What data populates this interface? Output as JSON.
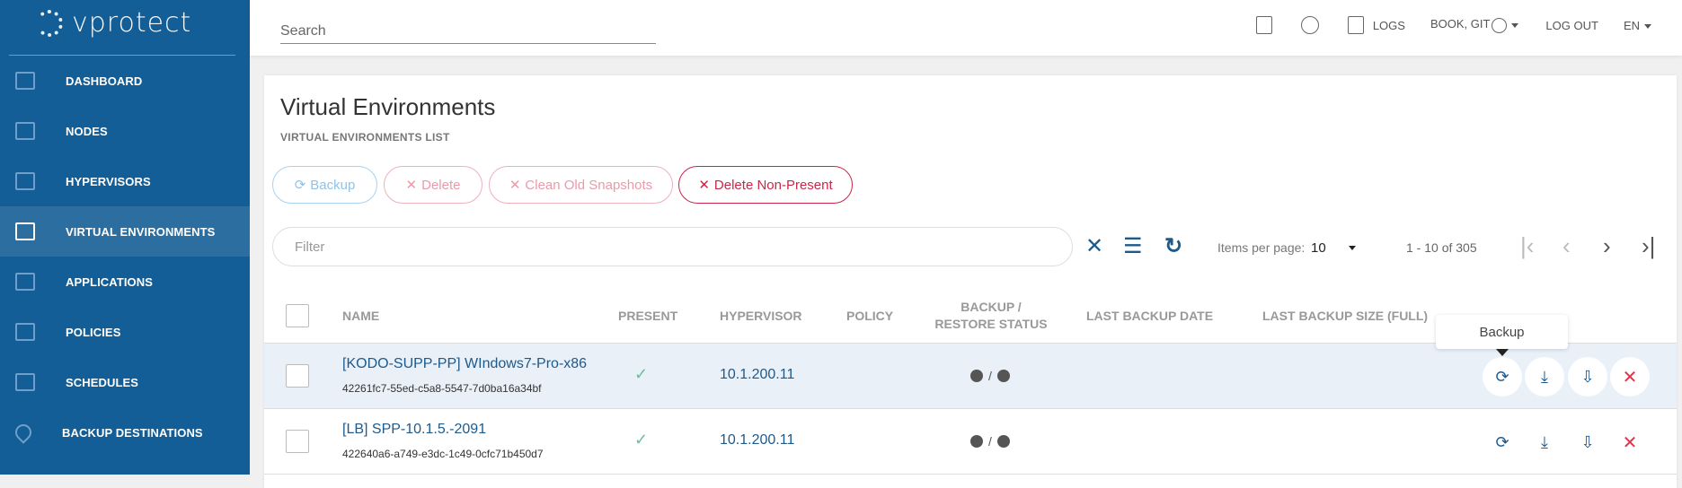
{
  "brand": {
    "name": "vprotect"
  },
  "sidebar": {
    "items": [
      {
        "label": "DASHBOARD",
        "icon": "bar-chart-icon"
      },
      {
        "label": "NODES",
        "icon": "archive-box-icon"
      },
      {
        "label": "HYPERVISORS",
        "icon": "grid-icon"
      },
      {
        "label": "VIRTUAL ENVIRONMENTS",
        "icon": "cube-icon",
        "active": true
      },
      {
        "label": "APPLICATIONS",
        "icon": "ruler-pencil-icon"
      },
      {
        "label": "POLICIES",
        "icon": "scroll-icon"
      },
      {
        "label": "SCHEDULES",
        "icon": "calendar-icon"
      },
      {
        "label": "BACKUP DESTINATIONS",
        "icon": "map-pin-icon"
      }
    ]
  },
  "topbar": {
    "search_placeholder": "Search",
    "logs": "LOGS",
    "user": "BOOK, GIT",
    "logout": "LOG OUT",
    "lang": "EN"
  },
  "page": {
    "title": "Virtual Environments",
    "subtitle": "VIRTUAL ENVIRONMENTS LIST"
  },
  "actions": {
    "backup": "Backup",
    "delete": "Delete",
    "clean": "Clean Old Snapshots",
    "delete_non_present": "Delete Non-Present"
  },
  "filter": {
    "placeholder": "Filter"
  },
  "pagination": {
    "items_per_page_label": "Items per page:",
    "items_per_page": "10",
    "range": "1 - 10 of 305"
  },
  "table": {
    "columns": {
      "name": "NAME",
      "present": "PRESENT",
      "hypervisor": "HYPERVISOR",
      "policy": "POLICY",
      "status_1": "BACKUP /",
      "status_2": "RESTORE STATUS",
      "last_date": "LAST BACKUP DATE",
      "last_size": "LAST BACKUP SIZE (FULL)"
    },
    "rows": [
      {
        "name": "[KODO-SUPP-PP] WIndows7-Pro-x86",
        "uuid": "42261fc7-55ed-c5a8-5547-7d0ba16a34bf",
        "present": "✓",
        "hypervisor": "10.1.200.11",
        "policy": "",
        "status_sep": "/",
        "last_date": "",
        "last_size": ""
      },
      {
        "name": "[LB] SPP-10.1.5.-2091",
        "uuid": "422640a6-a749-e3dc-1c49-0cfc71b450d7",
        "present": "✓",
        "hypervisor": "10.1.200.11",
        "policy": "",
        "status_sep": "/",
        "last_date": "",
        "last_size": ""
      }
    ]
  },
  "tooltip": {
    "text": "Backup"
  },
  "colors": {
    "sidebar": "#135e96",
    "accent": "#1d5a8c",
    "danger": "#e0344a",
    "highlight_row": "#e9f0f8"
  }
}
